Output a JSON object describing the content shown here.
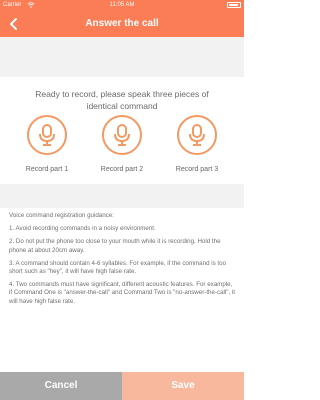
{
  "status_bar": {
    "carrier": "Carrier",
    "time": "11:05 AM"
  },
  "nav": {
    "title": "Answer the call",
    "back_icon": "chevron-left-icon"
  },
  "prompt": {
    "text": "Ready to record, please speak three pieces of identical command"
  },
  "record_parts": [
    {
      "label": "Record part 1",
      "icon": "microphone-icon"
    },
    {
      "label": "Record part 2",
      "icon": "microphone-icon"
    },
    {
      "label": "Record part 3",
      "icon": "microphone-icon"
    }
  ],
  "guidance": {
    "heading": "Voice command registration guidance:",
    "items": [
      "1. Avoid recording commands in a noisy environment.",
      "2. Do not put the phone too close to your mouth while it is recording.  Hold the phone at about 20cm away.",
      "3. A command should contain 4-6 syllables. For example, if the command is too short such as \"hey\", it will have high false rate.",
      "4. Two commands must have significant, different acoustic features. For example, if Command One is \"answer-the-call\" and Command Two is \"no-answer-the-call\", it will have high false rate."
    ]
  },
  "buttons": {
    "cancel": "Cancel",
    "save": "Save"
  },
  "colors": {
    "accent": "#fa7d55",
    "mic": "#f29a64",
    "cancel": "#a9a9a9",
    "save_disabled": "#f7b89e"
  }
}
